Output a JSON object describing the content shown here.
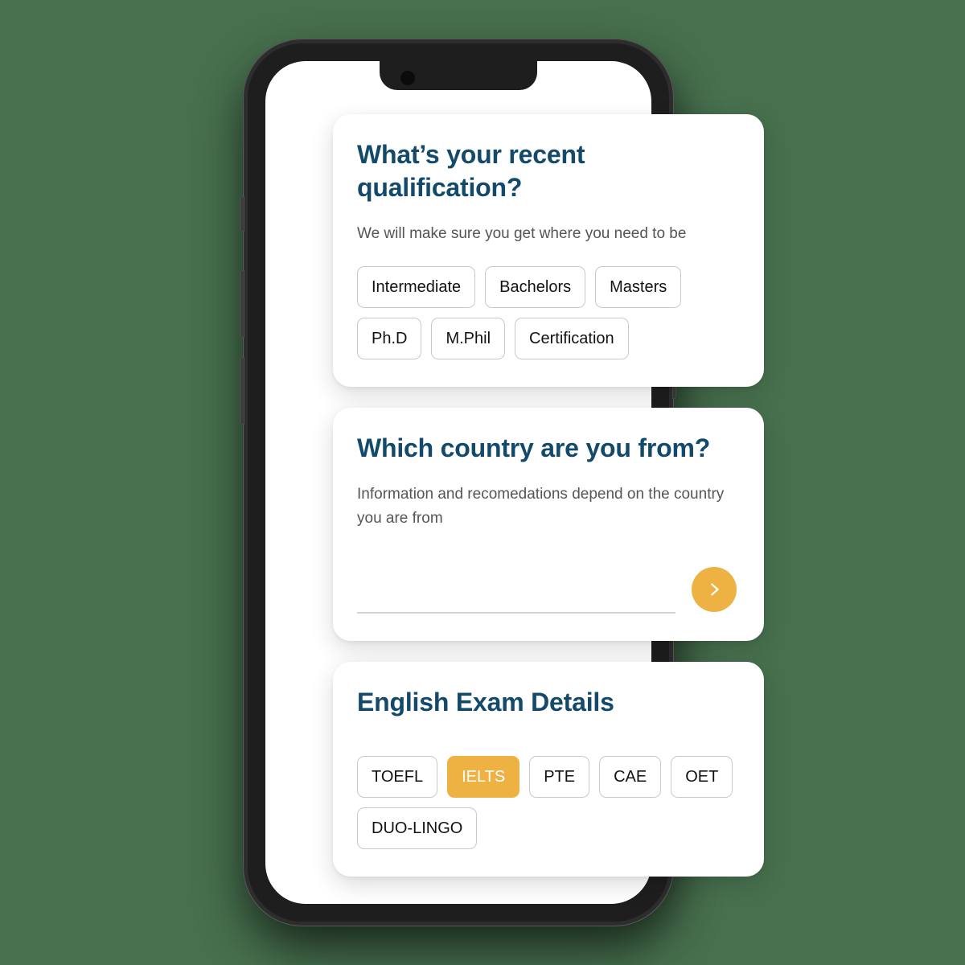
{
  "background_color": "#47704e",
  "accent_color": "#eeb242",
  "heading_color": "#13496b",
  "device": {
    "type": "smartphone-mockup",
    "frame_color": "#1e1e1e",
    "notch": {
      "camera_icon": "camera-dot-icon",
      "speaker_icon": "earpiece-speaker-icon"
    },
    "buttons": [
      {
        "name": "mute-switch"
      },
      {
        "name": "volume-up-button"
      },
      {
        "name": "volume-down-button"
      },
      {
        "name": "power-button"
      }
    ]
  },
  "cards": [
    {
      "id": "qualification",
      "title": "What’s your recent qualification?",
      "subtitle": "We will make sure you get where you need to be",
      "options": [
        {
          "label": "Intermediate",
          "selected": false
        },
        {
          "label": "Bachelors",
          "selected": false
        },
        {
          "label": "Masters",
          "selected": false
        },
        {
          "label": "Ph.D",
          "selected": false
        },
        {
          "label": "M.Phil",
          "selected": false
        },
        {
          "label": "Certification",
          "selected": false
        }
      ]
    },
    {
      "id": "country",
      "title": "Which country are you from?",
      "subtitle": "Information and recomedations depend on the country you are from",
      "input": {
        "value": "",
        "placeholder": ""
      },
      "next_button": {
        "icon": "chevron-right-icon",
        "label": ""
      }
    },
    {
      "id": "english-exam",
      "title": "English Exam Details",
      "options": [
        {
          "label": "TOEFL",
          "selected": false
        },
        {
          "label": "IELTS",
          "selected": true
        },
        {
          "label": "PTE",
          "selected": false
        },
        {
          "label": "CAE",
          "selected": false
        },
        {
          "label": "OET",
          "selected": false
        },
        {
          "label": "DUO-LINGO",
          "selected": false
        }
      ]
    }
  ]
}
